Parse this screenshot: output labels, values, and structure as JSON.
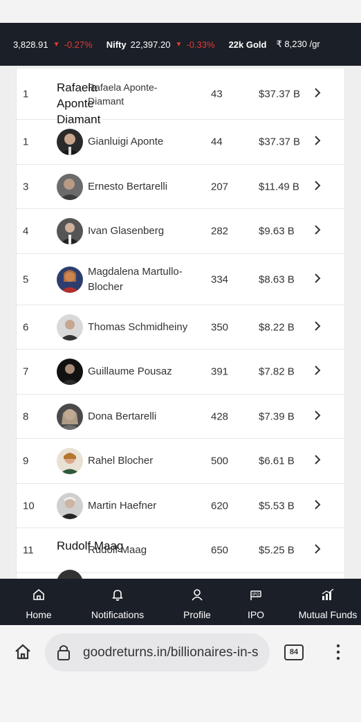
{
  "ticker": [
    {
      "name": "",
      "value": "3,828.91",
      "change": "-0.27%"
    },
    {
      "name": "Nifty",
      "value": "22,397.20",
      "change": "-0.33%"
    },
    {
      "name": "22k Gold",
      "value": "₹ 8,230 /gr"
    }
  ],
  "colors": {
    "dark_bar": "#1b1f27",
    "negative": "#e53935"
  },
  "rows": [
    {
      "rank": "1",
      "name": "Rafaela Aponte-Diamant",
      "alt": "Rafaela Aponte Diamant",
      "age": "43",
      "worth": "$37.37 B"
    },
    {
      "rank": "1",
      "name": "Gianluigi Aponte",
      "age": "44",
      "worth": "$37.37 B"
    },
    {
      "rank": "3",
      "name": "Ernesto Bertarelli",
      "age": "207",
      "worth": "$11.49 B"
    },
    {
      "rank": "4",
      "name": "Ivan Glasenberg",
      "age": "282",
      "worth": "$9.63 B"
    },
    {
      "rank": "5",
      "name": "Magdalena Martullo-Blocher",
      "age": "334",
      "worth": "$8.63 B"
    },
    {
      "rank": "6",
      "name": "Thomas Schmidheiny",
      "age": "350",
      "worth": "$8.22 B"
    },
    {
      "rank": "7",
      "name": "Guillaume Pousaz",
      "age": "391",
      "worth": "$7.82 B"
    },
    {
      "rank": "8",
      "name": "Dona Bertarelli",
      "age": "428",
      "worth": "$7.39 B"
    },
    {
      "rank": "9",
      "name": "Rahel Blocher",
      "age": "500",
      "worth": "$6.61 B"
    },
    {
      "rank": "10",
      "name": "Martin Haefner",
      "age": "620",
      "worth": "$5.53 B"
    },
    {
      "rank": "11",
      "name": "Rudolf Maag",
      "alt": "Rudolf Maag",
      "age": "650",
      "worth": "$5.25 B"
    }
  ],
  "bottom_nav": [
    {
      "label": "Home",
      "icon": "home-icon"
    },
    {
      "label": "Notifications",
      "icon": "bell-icon"
    },
    {
      "label": "Profile",
      "icon": "user-icon"
    },
    {
      "label": "IPO",
      "icon": "ipo-icon"
    },
    {
      "label": "Mutual Funds",
      "icon": "chart-icon"
    }
  ],
  "browser": {
    "url": "goodreturns.in/billionaires-in-s",
    "tab_count": "84"
  }
}
